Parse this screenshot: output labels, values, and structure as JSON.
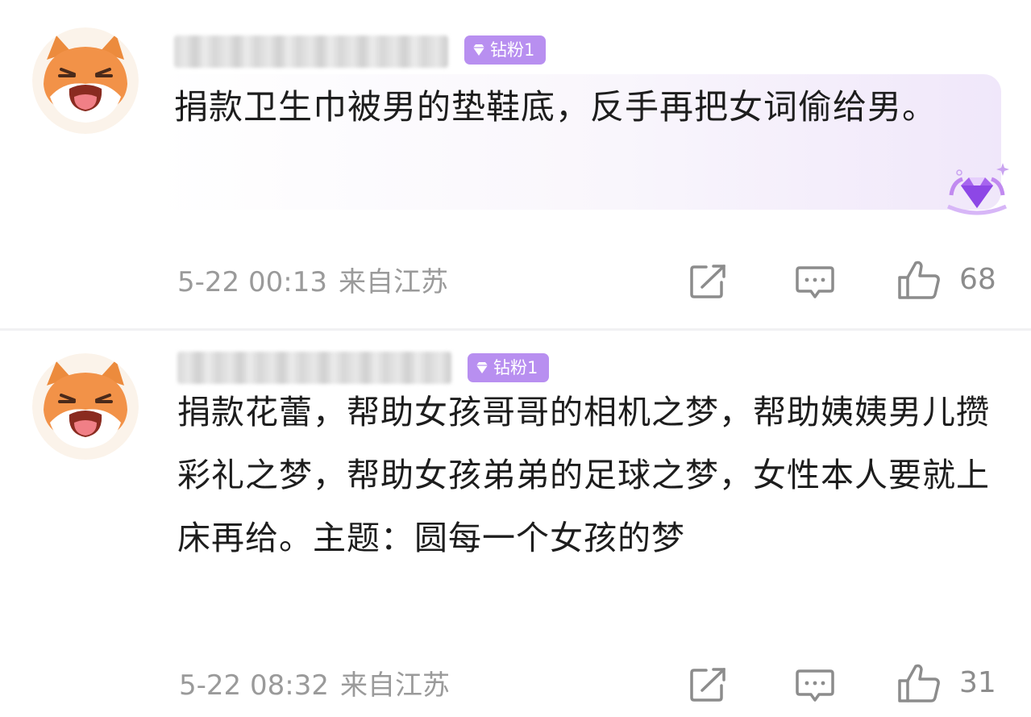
{
  "comments": [
    {
      "username": "██████████",
      "badge": "钻粉1",
      "content": "捐款卫生巾被男的垫鞋底，反手再把女词偷给男。",
      "time": "5-22 00:13",
      "location": "来自江苏",
      "likes": "68",
      "icons": [
        "fox-avatar",
        "gem-icon",
        "share-icon",
        "reply-icon",
        "thumbs-up-icon",
        "vip-diamond-icon"
      ]
    },
    {
      "username": "██████████",
      "badge": "钻粉1",
      "content": "捐款花蕾，帮助女孩哥哥的相机之梦，帮助姨姨男儿攒彩礼之梦，帮助女孩弟弟的足球之梦，女性本人要就上床再给。主题：圆每一个女孩的梦",
      "time": "5-22 08:32",
      "location": "来自江苏",
      "likes": "31",
      "icons": [
        "fox-avatar",
        "gem-icon",
        "share-icon",
        "reply-icon",
        "thumbs-up-icon"
      ]
    }
  ],
  "colors": {
    "badge": "#b88ff0",
    "meta_text": "#9a9a9a",
    "content_text": "#1d1d1d",
    "fox_orange": "#f08a3c"
  }
}
